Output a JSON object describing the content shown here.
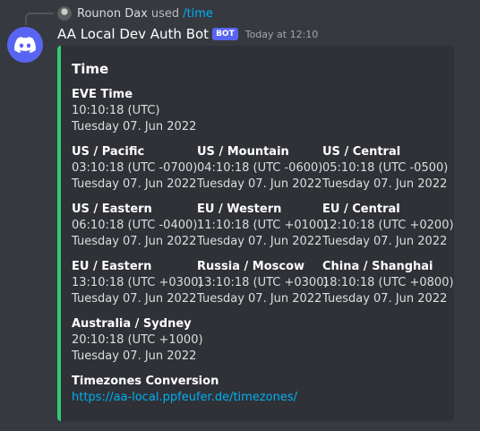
{
  "reply": {
    "user": "Rounon Dax",
    "used": "used",
    "command": "/time"
  },
  "message": {
    "author": "AA Local Dev Auth Bot",
    "tag": "BOT",
    "timestamp": "Today at 12:10"
  },
  "embed": {
    "title": "Time",
    "color": "#2ecc71",
    "fields": [
      {
        "name": "EVE Time",
        "time": "10:10:18 (UTC)",
        "date": "Tuesday 07. Jun 2022"
      },
      {
        "name": "US / Pacific",
        "time": "03:10:18 (UTC -0700)",
        "date": "Tuesday 07. Jun 2022"
      },
      {
        "name": "US / Mountain",
        "time": "04:10:18 (UTC -0600)",
        "date": "Tuesday 07. Jun 2022"
      },
      {
        "name": "US / Central",
        "time": "05:10:18 (UTC -0500)",
        "date": "Tuesday 07. Jun 2022"
      },
      {
        "name": "US / Eastern",
        "time": "06:10:18 (UTC -0400)",
        "date": "Tuesday 07. Jun 2022"
      },
      {
        "name": "EU / Western",
        "time": "11:10:18 (UTC +0100)",
        "date": "Tuesday 07. Jun 2022"
      },
      {
        "name": "EU / Central",
        "time": "12:10:18 (UTC +0200)",
        "date": "Tuesday 07. Jun 2022"
      },
      {
        "name": "EU / Eastern",
        "time": "13:10:18 (UTC +0300)",
        "date": "Tuesday 07. Jun 2022"
      },
      {
        "name": "Russia / Moscow",
        "time": "13:10:18 (UTC +0300)",
        "date": "Tuesday 07. Jun 2022"
      },
      {
        "name": "China / Shanghai",
        "time": "18:10:18 (UTC +0800)",
        "date": "Tuesday 07. Jun 2022"
      },
      {
        "name": "Australia / Sydney",
        "time": "20:10:18 (UTC +1000)",
        "date": "Tuesday 07. Jun 2022"
      }
    ],
    "conversion": {
      "name": "Timezones Conversion",
      "link": "https://aa-local.ppfeufer.de/timezones/"
    }
  },
  "icons": {
    "avatar": "discord-logo-icon",
    "reply_avatar": "user-avatar-icon"
  }
}
